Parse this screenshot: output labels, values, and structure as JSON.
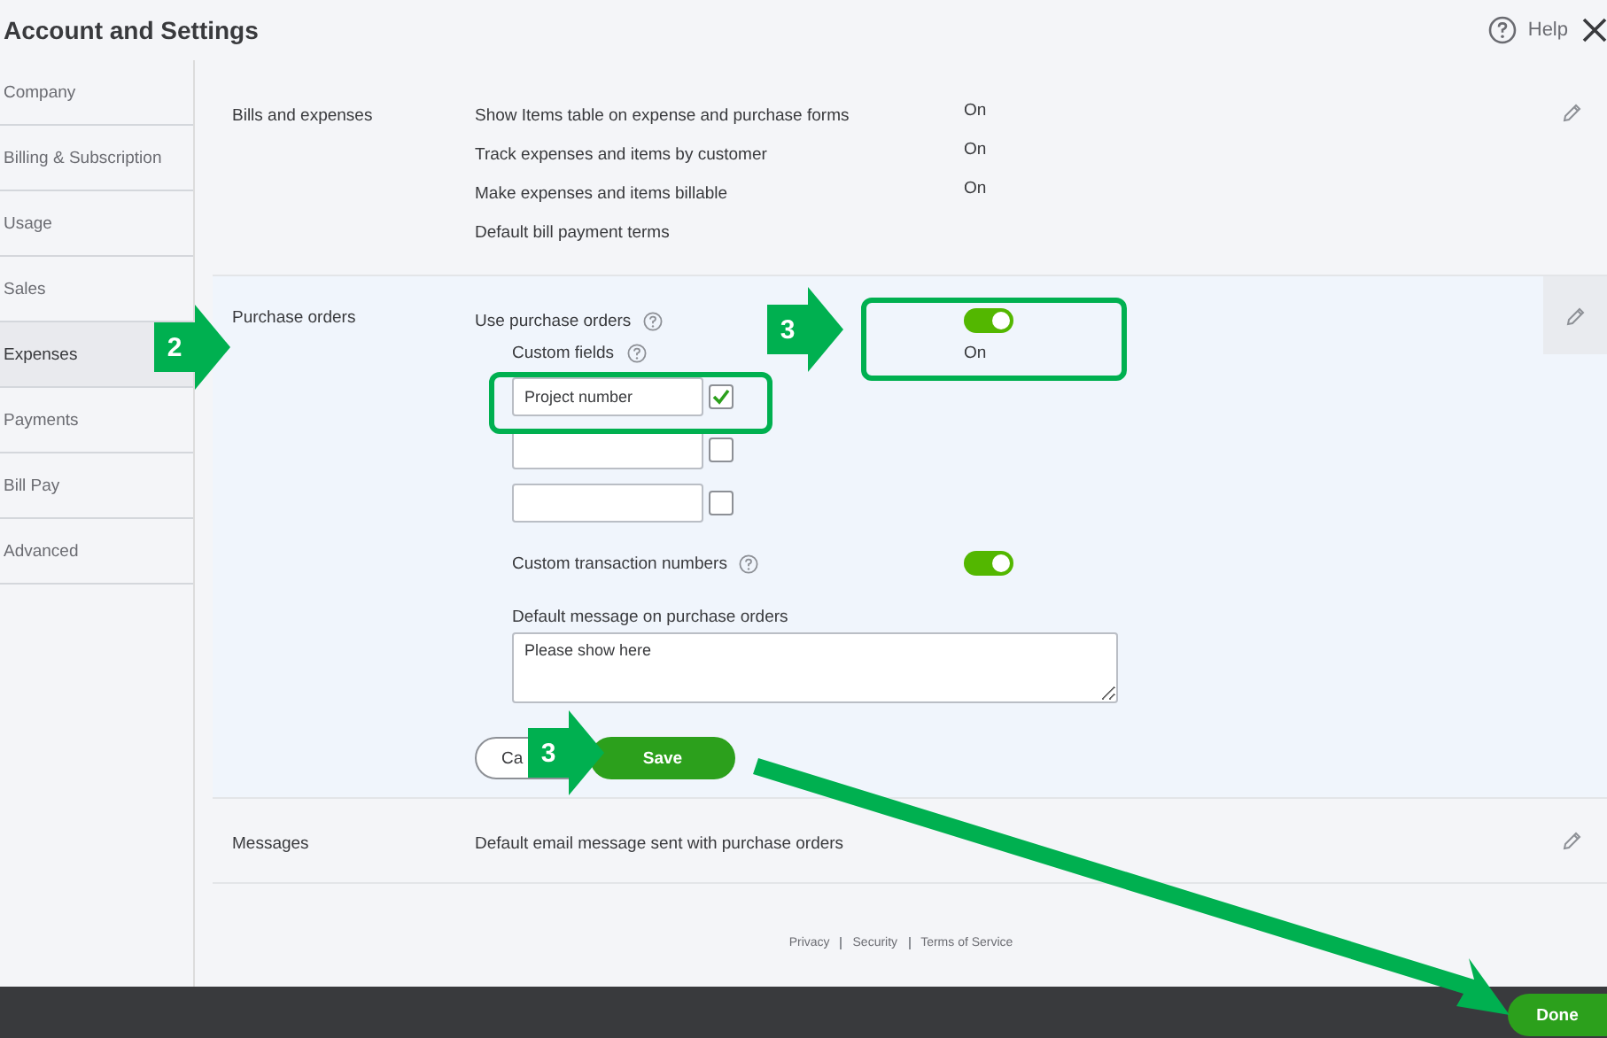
{
  "window": {
    "title": "Account and Settings",
    "help": "Help"
  },
  "sidebar": {
    "items": [
      {
        "label": "Company",
        "selected": false
      },
      {
        "label": "Billing & Subscription",
        "selected": false
      },
      {
        "label": "Usage",
        "selected": false
      },
      {
        "label": "Sales",
        "selected": false
      },
      {
        "label": "Expenses",
        "selected": true
      },
      {
        "label": "Payments",
        "selected": false
      },
      {
        "label": "Bill Pay",
        "selected": false
      },
      {
        "label": "Advanced",
        "selected": false
      }
    ]
  },
  "bills": {
    "title": "Bills and expenses",
    "rows": [
      {
        "label": "Show Items table on expense and purchase forms",
        "value": "On"
      },
      {
        "label": "Track expenses and items by customer",
        "value": "On"
      },
      {
        "label": "Make expenses and items billable",
        "value": "On"
      },
      {
        "label": "Default bill payment terms"
      }
    ]
  },
  "purchase_orders": {
    "title": "Purchase orders",
    "use_label": "Use purchase orders",
    "use_on": true,
    "use_value": "On",
    "custom_fields_label": "Custom fields",
    "custom_fields": [
      {
        "value": "Project number",
        "checked": true
      },
      {
        "checked": false
      },
      {
        "checked": false
      }
    ],
    "numbers_label": "Custom transaction numbers",
    "numbers_on": true,
    "message_label": "Default message on purchase orders",
    "message_value": "Please show here",
    "cancel": "Ca",
    "save": "Save"
  },
  "messages": {
    "title": "Messages",
    "rows": [
      {
        "label": "Default email message sent with purchase orders"
      }
    ]
  },
  "footer_links": [
    "Privacy",
    "Security",
    "Terms of Service"
  ],
  "done": "Done",
  "callouts": [
    "2",
    "3",
    "3"
  ]
}
